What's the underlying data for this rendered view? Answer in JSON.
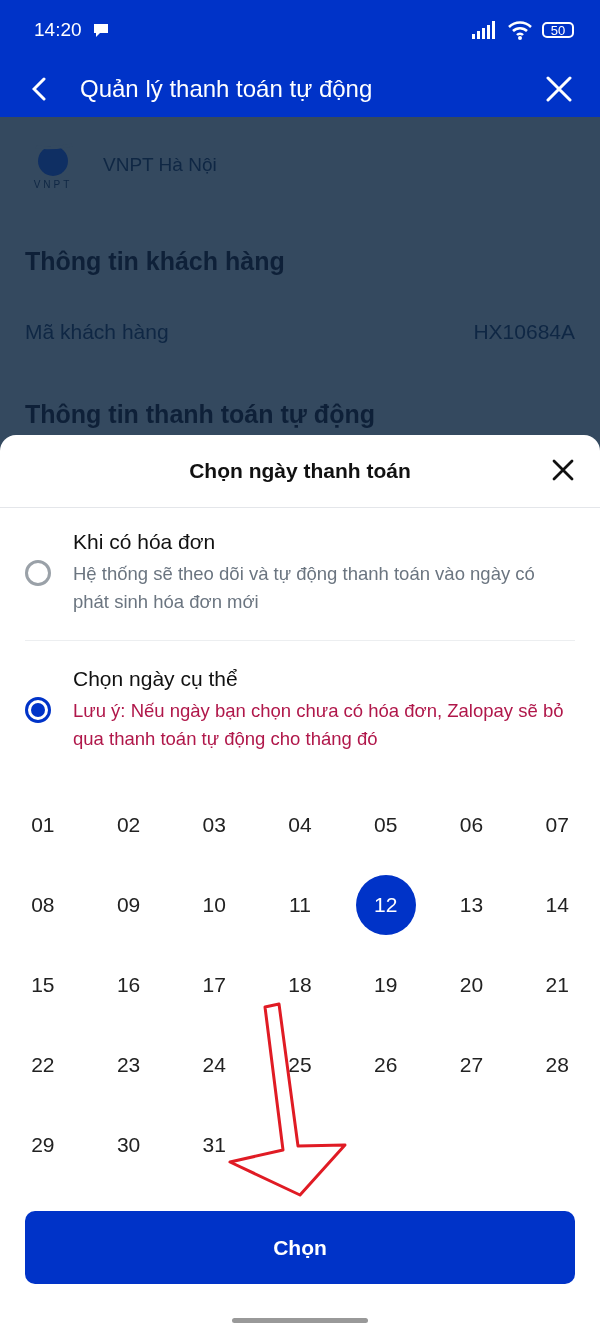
{
  "status_bar": {
    "time": "14:20",
    "battery": "50"
  },
  "header": {
    "title": "Quản lý thanh toán tự động"
  },
  "background": {
    "logo_text": "VNPT",
    "provider": "VNPT Hà Nội",
    "section_title": "Thông tin khách hàng",
    "fields": [
      {
        "label": "Mã khách hàng",
        "value": "HX10684A"
      }
    ],
    "next_section_title": "Thông tin thanh toán tự động"
  },
  "sheet": {
    "title": "Chọn ngày thanh toán",
    "options": [
      {
        "kind": "info",
        "title": "Khi có hóa đơn",
        "description": "Hệ thống sẽ theo dõi và tự động thanh toán vào ngày có phát sinh hóa đơn mới",
        "selected": false
      },
      {
        "kind": "warning",
        "title": "Chọn ngày cụ thể",
        "description": "Lưu ý: Nếu ngày bạn chọn chưa có hóa đơn, Zalopay sẽ bỏ qua thanh toán tự động cho tháng đó",
        "selected": true
      }
    ],
    "days": [
      {
        "label": "01",
        "selected": false
      },
      {
        "label": "02",
        "selected": false
      },
      {
        "label": "03",
        "selected": false
      },
      {
        "label": "04",
        "selected": false
      },
      {
        "label": "05",
        "selected": false
      },
      {
        "label": "06",
        "selected": false
      },
      {
        "label": "07",
        "selected": false
      },
      {
        "label": "08",
        "selected": false
      },
      {
        "label": "09",
        "selected": false
      },
      {
        "label": "10",
        "selected": false
      },
      {
        "label": "11",
        "selected": false
      },
      {
        "label": "12",
        "selected": true
      },
      {
        "label": "13",
        "selected": false
      },
      {
        "label": "14",
        "selected": false
      },
      {
        "label": "15",
        "selected": false
      },
      {
        "label": "16",
        "selected": false
      },
      {
        "label": "17",
        "selected": false
      },
      {
        "label": "18",
        "selected": false
      },
      {
        "label": "19",
        "selected": false
      },
      {
        "label": "20",
        "selected": false
      },
      {
        "label": "21",
        "selected": false
      },
      {
        "label": "22",
        "selected": false
      },
      {
        "label": "23",
        "selected": false
      },
      {
        "label": "24",
        "selected": false
      },
      {
        "label": "25",
        "selected": false
      },
      {
        "label": "26",
        "selected": false
      },
      {
        "label": "27",
        "selected": false
      },
      {
        "label": "28",
        "selected": false
      },
      {
        "label": "29",
        "selected": false
      },
      {
        "label": "30",
        "selected": false
      },
      {
        "label": "31",
        "selected": false
      }
    ],
    "button": "Chọn"
  }
}
